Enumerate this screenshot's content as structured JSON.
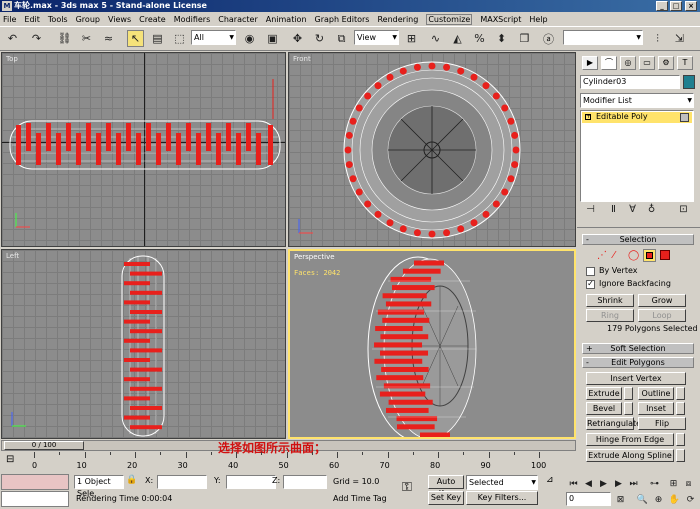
{
  "window": {
    "title": "车轮.max - 3ds max 5 - Stand-alone License",
    "minimize": "_",
    "maximize": "□",
    "close": "×"
  },
  "menu": [
    "File",
    "Edit",
    "Tools",
    "Group",
    "Views",
    "Create",
    "Modifiers",
    "Character",
    "Animation",
    "Graph Editors",
    "Rendering",
    "Customize",
    "MAXScript",
    "Help"
  ],
  "toolbar": {
    "selection_filter": "All",
    "ref_coord": "View",
    "named_selection": ""
  },
  "viewports": {
    "top": "Top",
    "front": "Front",
    "left": "Left",
    "perspective": "Perspective",
    "faces_label": "Faces: 2042"
  },
  "panel": {
    "tabs": [
      "▶",
      "⌒",
      "◎",
      "▭",
      "⚙",
      "T"
    ],
    "object_name": "Cylinder03",
    "modifier_list": "Modifier List",
    "stack_item": "Editable Poly",
    "selection_title": "Selection",
    "by_vertex": "By Vertex",
    "ignore_backfacing": "Ignore Backfacing",
    "shrink": "Shrink",
    "grow": "Grow",
    "ring": "Ring",
    "loop": "Loop",
    "selected_info": "179 Polygons Selected",
    "soft_selection": "Soft Selection",
    "edit_polygons": "Edit Polygons",
    "insert_vertex": "Insert Vertex",
    "extrude": "Extrude",
    "outline": "Outline",
    "bevel": "Bevel",
    "inset": "Inset",
    "retriangulate": "Retriangulate",
    "flip": "Flip",
    "hinge": "Hinge From Edge",
    "extrude_spline": "Extrude Along Spline"
  },
  "timeline": {
    "frame": "0 / 100",
    "ticks": [
      "0",
      "10",
      "20",
      "30",
      "40",
      "50",
      "60",
      "70",
      "80",
      "90",
      "100"
    ],
    "caption": "选择如图所示曲面；"
  },
  "status": {
    "object_sel": "1 Object Sele",
    "x_label": "X:",
    "y_label": "Y:",
    "z_label": "Z:",
    "grid": "Grid = 10.0",
    "render_time": "Rendering Time  0:00:04",
    "add_time_tag": "Add Time Tag",
    "auto_key": "Auto Key",
    "set_key": "Set Key",
    "key_mode": "Selected",
    "key_filters": "Key Filters...",
    "frame_field": "0"
  }
}
